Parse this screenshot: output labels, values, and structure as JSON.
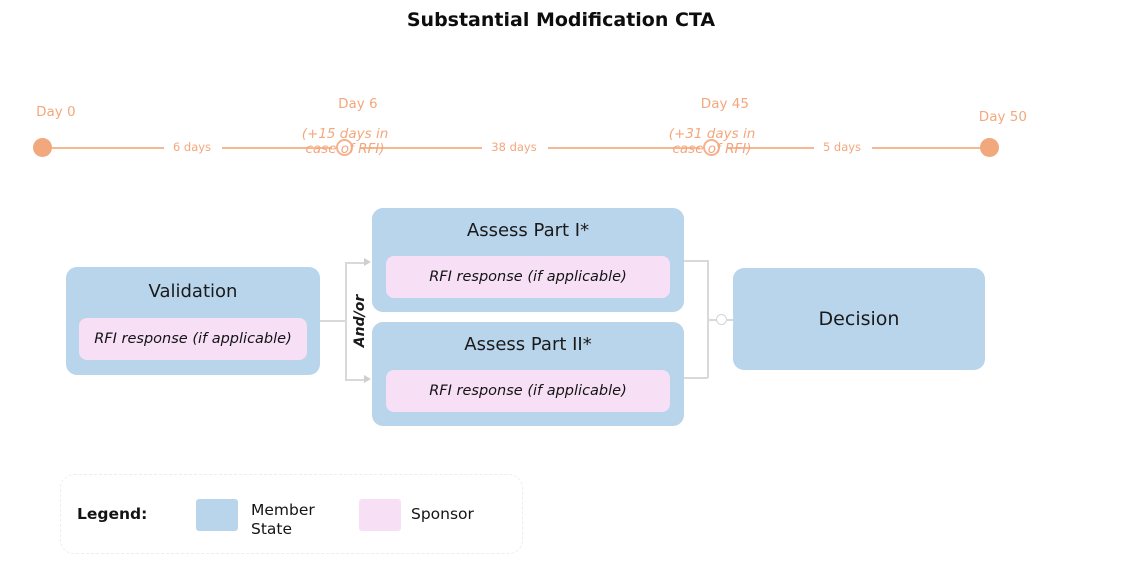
{
  "title": "Substantial Modification CTA",
  "colors": {
    "member_state": "#b9d5ec",
    "sponsor": "#f7e0f6",
    "timeline": "#f4a77c",
    "connector": "#d9d9d9"
  },
  "timeline": {
    "milestones": [
      {
        "label": "Day 0",
        "sub": "",
        "marker": "filled-dot"
      },
      {
        "label": "Day 6",
        "sub": "(+15 days in\ncase of RFI)",
        "marker": "open-ring"
      },
      {
        "label": "Day 45",
        "sub": "(+31 days in\ncase of RFI)",
        "marker": "open-ring"
      },
      {
        "label": "Day 50",
        "sub": "",
        "marker": "filled-dot"
      }
    ],
    "durations": [
      "6 days",
      "38 days",
      "5 days"
    ]
  },
  "flow": {
    "validation": {
      "title": "Validation",
      "rfi": "RFI response (if applicable)"
    },
    "assess_part_1": {
      "title": "Assess Part I*",
      "rfi": "RFI response (if applicable)"
    },
    "assess_part_2": {
      "title": "Assess Part II*",
      "rfi": "RFI response (if applicable)"
    },
    "branch_label": "And/or",
    "decision": {
      "title": "Decision"
    }
  },
  "legend": {
    "title": "Legend:",
    "items": [
      {
        "label": "Member\nState",
        "color": "#b9d5ec"
      },
      {
        "label": "Sponsor",
        "color": "#f7e0f6"
      }
    ]
  }
}
